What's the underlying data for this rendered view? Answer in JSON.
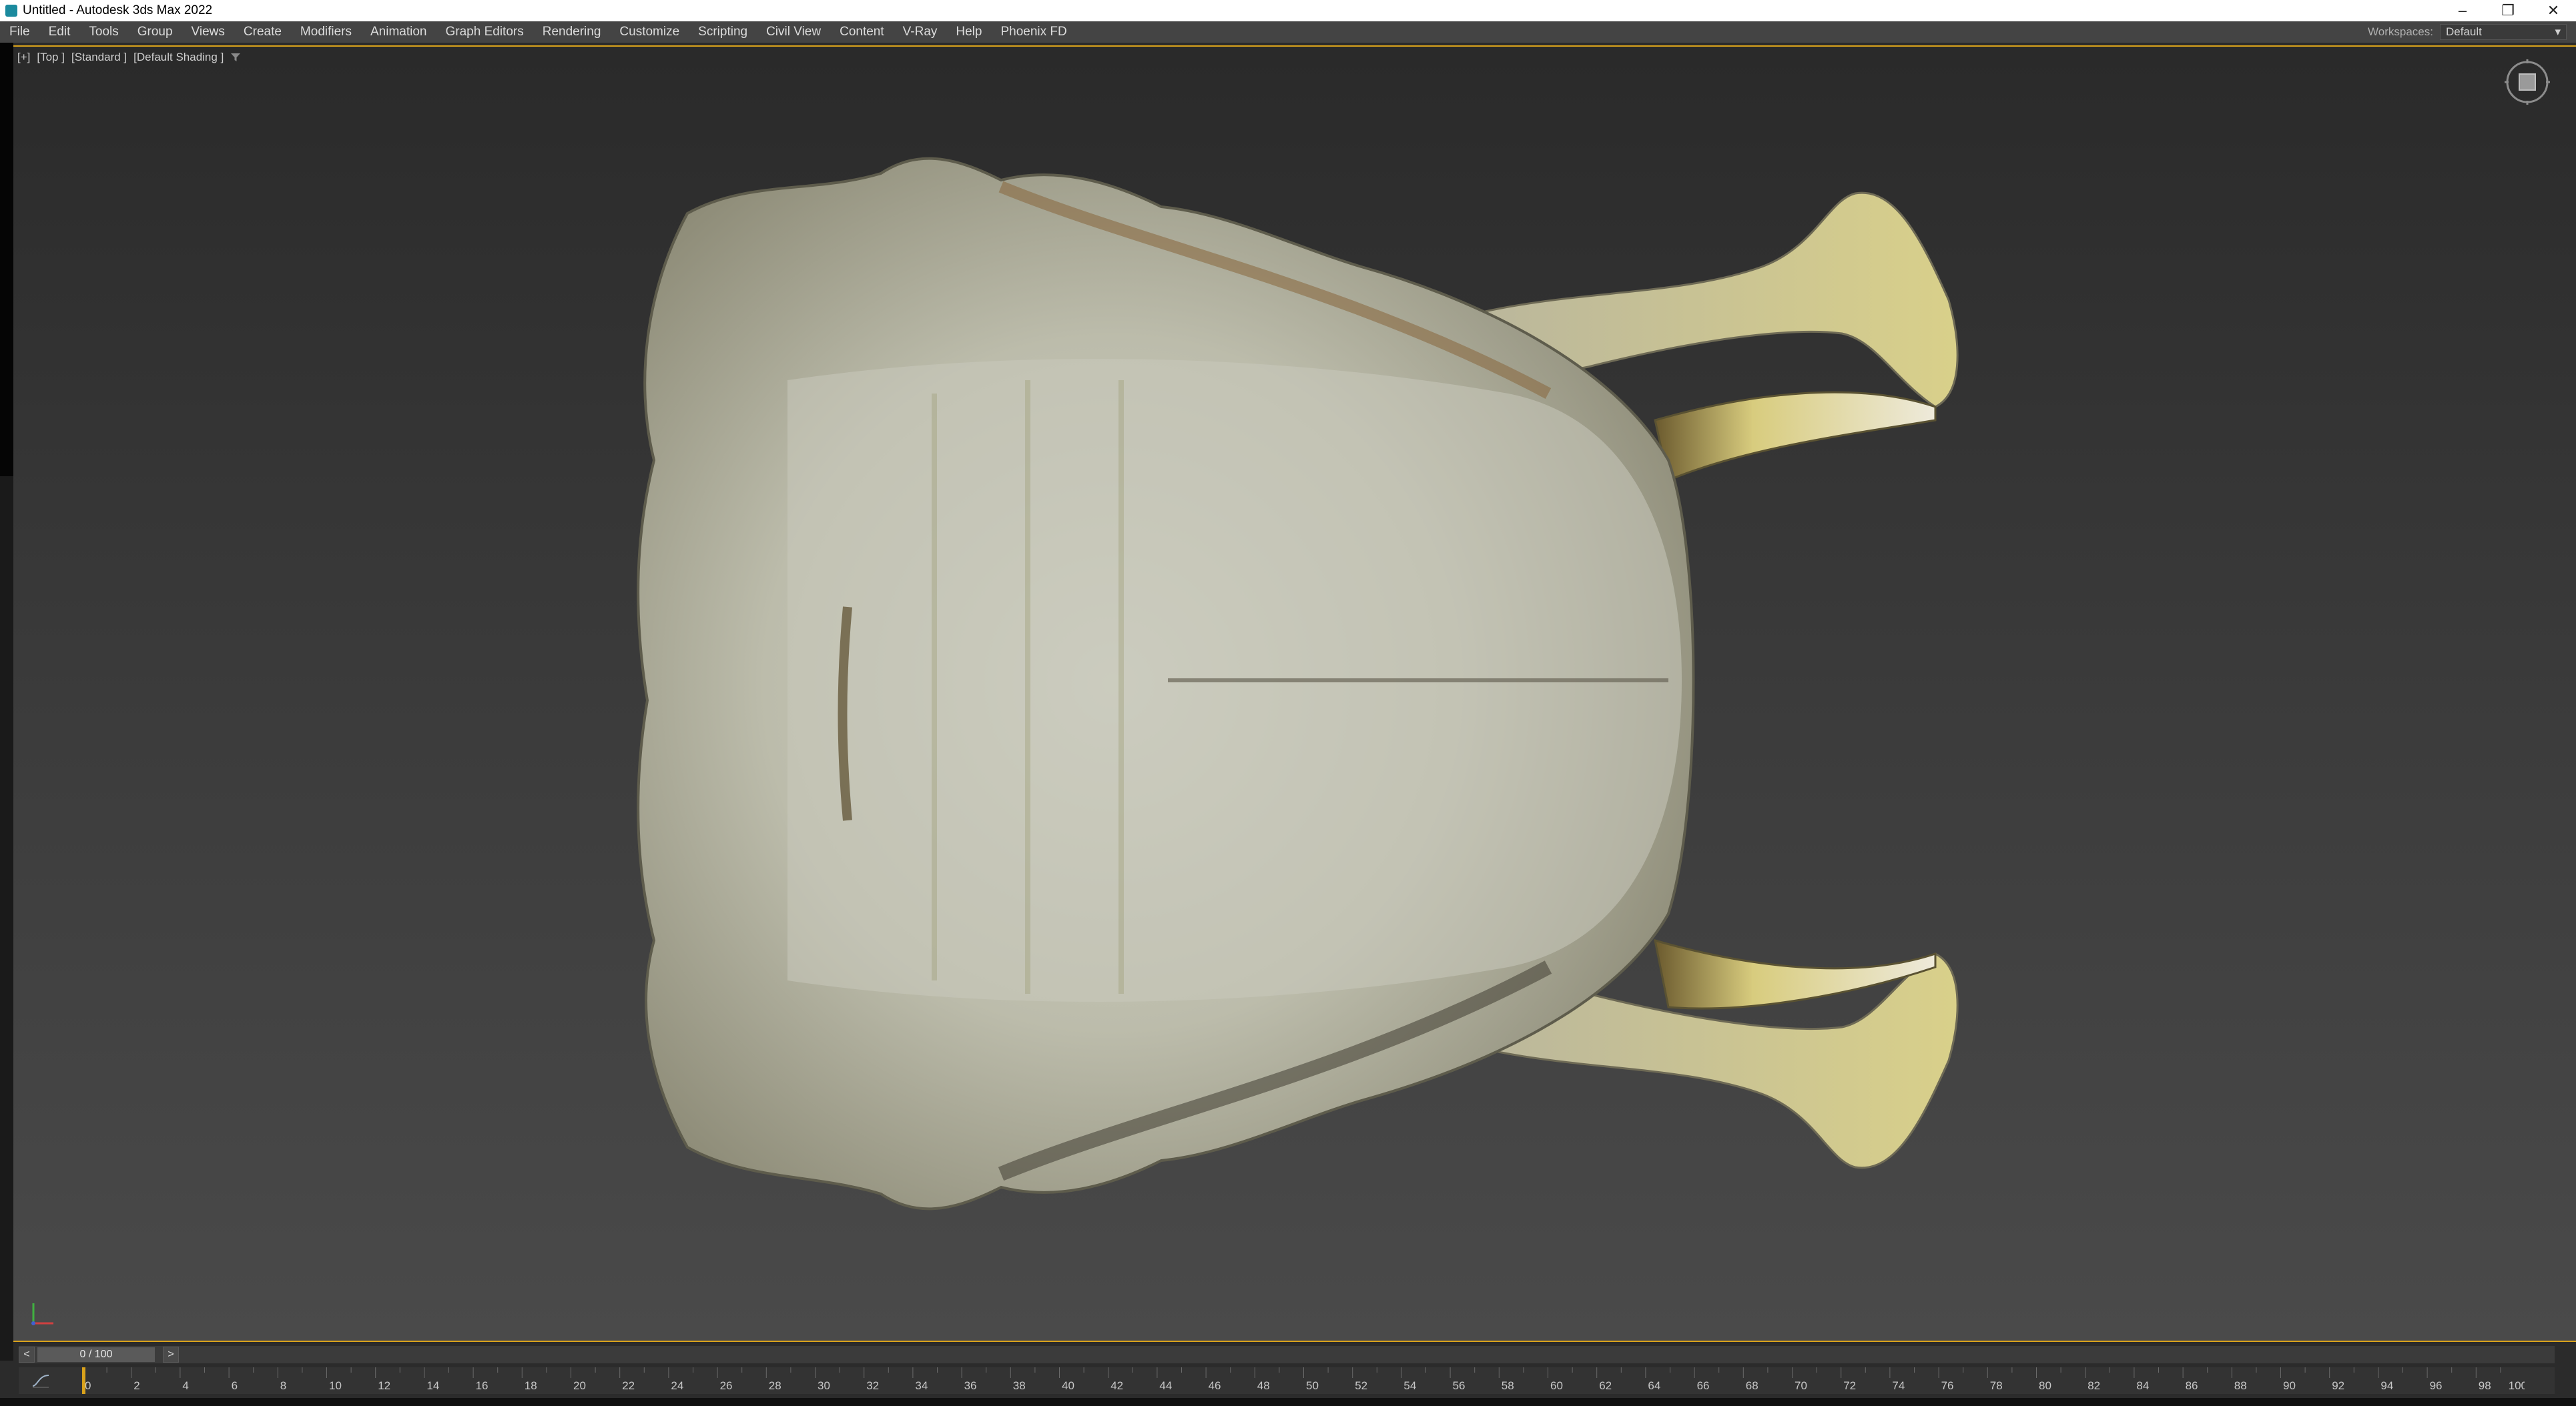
{
  "window": {
    "title": "Untitled - Autodesk 3ds Max 2022",
    "controls": [
      "–",
      "❐",
      "✕"
    ]
  },
  "menu": {
    "items": [
      "File",
      "Edit",
      "Tools",
      "Group",
      "Views",
      "Create",
      "Modifiers",
      "Animation",
      "Graph Editors",
      "Rendering",
      "Customize",
      "Scripting",
      "Civil View",
      "Content",
      "V-Ray",
      "Help",
      "Phoenix FD"
    ],
    "workspaces_label": "Workspaces:",
    "workspaces_value": "Default"
  },
  "viewport": {
    "label_plus": "[+]",
    "label_view": "[Top ]",
    "label_mode": "[Standard ]",
    "label_shading": "[Default Shading ]",
    "border_color": "#d9a21b"
  },
  "timeline": {
    "prev": "<",
    "next": ">",
    "frame": "0 / 100",
    "ticks": [
      "0",
      "2",
      "4",
      "6",
      "8",
      "10",
      "12",
      "14",
      "16",
      "18",
      "20",
      "22",
      "24",
      "26",
      "28",
      "30",
      "32",
      "34",
      "36",
      "38",
      "40",
      "42",
      "44",
      "46",
      "48",
      "50",
      "52",
      "54",
      "56",
      "58",
      "60",
      "62",
      "64",
      "66",
      "68",
      "70",
      "72",
      "74",
      "76",
      "78",
      "80",
      "82",
      "84",
      "86",
      "88",
      "90",
      "92",
      "94",
      "96",
      "98",
      "100"
    ]
  },
  "icons": {
    "app": "3ds-max-app-icon",
    "filter": "filter-icon",
    "viewcube": "viewcube-icon",
    "axis": "axis-tripod-icon"
  }
}
